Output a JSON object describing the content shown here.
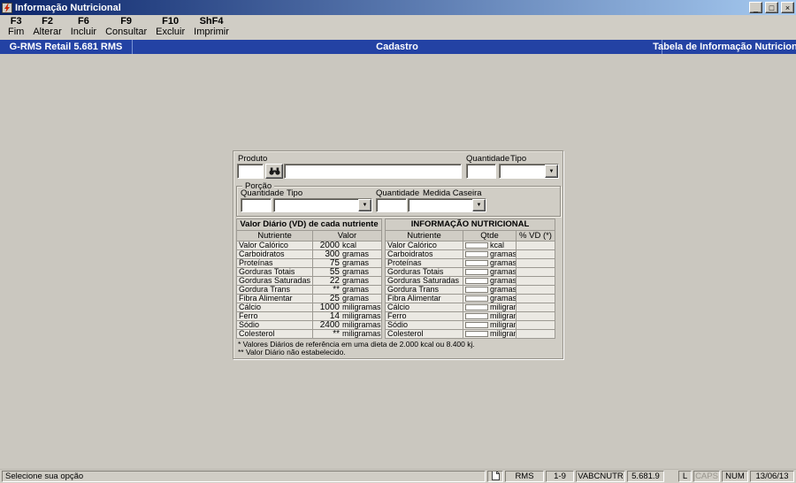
{
  "window": {
    "title": "Informação Nutricional",
    "controls": {
      "minimize": "_",
      "maximize": "□",
      "close": "×"
    }
  },
  "toolbar": {
    "buttons": [
      {
        "key": "F3",
        "label": "Fim"
      },
      {
        "key": "F2",
        "label": "Alterar"
      },
      {
        "key": "F6",
        "label": "Incluir"
      },
      {
        "key": "F9",
        "label": "Consultar"
      },
      {
        "key": "F10",
        "label": "Excluir"
      },
      {
        "key": "ShF4",
        "label": "Imprimir"
      }
    ]
  },
  "header": {
    "product": "G-RMS Retail 5.681 RMS",
    "section": "Cadastro",
    "screen": "Tabela de Informação Nutricional"
  },
  "form": {
    "produto_label": "Produto",
    "produto_code": "",
    "produto_description": "",
    "quantidade_label": "Quantidade",
    "quantidade_value": "",
    "tipo_label": "Tipo",
    "tipo_value": "",
    "porcao": {
      "title": "Porção",
      "quantidade_label": "Quantidade",
      "quantidade_value": "",
      "tipo_label": "Tipo",
      "tipo_value": "",
      "quantidade2_label": "Quantidade",
      "quantidade2_value": "",
      "medida_caseira_label": "Medida Caseira",
      "medida_caseira_value": ""
    }
  },
  "vd_table": {
    "title": "Valor Diário (VD) de cada nutriente",
    "columns": {
      "nutriente": "Nutriente",
      "valor": "Valor"
    },
    "rows": [
      {
        "nutriente": "Valor Calórico",
        "valor": "2000",
        "unidade": "kcal"
      },
      {
        "nutriente": "Carboidratos",
        "valor": "300",
        "unidade": "gramas"
      },
      {
        "nutriente": "Proteínas",
        "valor": "75",
        "unidade": "gramas"
      },
      {
        "nutriente": "Gorduras Totais",
        "valor": "55",
        "unidade": "gramas"
      },
      {
        "nutriente": "Gorduras Saturadas",
        "valor": "22",
        "unidade": "gramas"
      },
      {
        "nutriente": "Gordura Trans",
        "valor": "**",
        "unidade": "gramas"
      },
      {
        "nutriente": "Fibra Alimentar",
        "valor": "25",
        "unidade": "gramas"
      },
      {
        "nutriente": "Cálcio",
        "valor": "1000",
        "unidade": "miligramas"
      },
      {
        "nutriente": "Ferro",
        "valor": "14",
        "unidade": "miligramas"
      },
      {
        "nutriente": "Sódio",
        "valor": "2400",
        "unidade": "miligramas"
      },
      {
        "nutriente": "Colesterol",
        "valor": "**",
        "unidade": "miligramas"
      }
    ]
  },
  "info_table": {
    "title": "INFORMAÇÃO NUTRICIONAL",
    "columns": {
      "nutriente": "Nutriente",
      "qtde": "Qtde",
      "vd": "% VD (*)"
    },
    "rows": [
      {
        "nutriente": "Valor Calórico",
        "qtde": "",
        "unidade": "kcal",
        "vd": ""
      },
      {
        "nutriente": "Carboidratos",
        "qtde": "",
        "unidade": "gramas",
        "vd": ""
      },
      {
        "nutriente": "Proteínas",
        "qtde": "",
        "unidade": "gramas",
        "vd": ""
      },
      {
        "nutriente": "Gorduras Totais",
        "qtde": "",
        "unidade": "gramas",
        "vd": ""
      },
      {
        "nutriente": "Gorduras Saturadas",
        "qtde": "",
        "unidade": "gramas",
        "vd": ""
      },
      {
        "nutriente": "Gordura Trans",
        "qtde": "",
        "unidade": "gramas",
        "vd": ""
      },
      {
        "nutriente": "Fibra Alimentar",
        "qtde": "",
        "unidade": "gramas",
        "vd": ""
      },
      {
        "nutriente": "Cálcio",
        "qtde": "",
        "unidade": "miligramas",
        "vd": ""
      },
      {
        "nutriente": "Ferro",
        "qtde": "",
        "unidade": "miligramas",
        "vd": ""
      },
      {
        "nutriente": "Sódio",
        "qtde": "",
        "unidade": "miligramas",
        "vd": ""
      },
      {
        "nutriente": "Colesterol",
        "qtde": "",
        "unidade": "miligramas",
        "vd": ""
      }
    ]
  },
  "footnotes": [
    "* Valores Diários de referência em uma dieta de 2.000 kcal ou 8.400 kj.",
    "** Valor Diário não estabelecido."
  ],
  "statusbar": {
    "message": "Selecione sua opção",
    "system": "RMS",
    "record_range": "1-9",
    "program": "VABCNUTR",
    "version": "5.681.9",
    "scroll_lock": "L",
    "caps_lock": "CAPS",
    "num_lock": "NUM",
    "date": "13/06/13"
  },
  "icons": {
    "app": "lightning",
    "search": "binoculars",
    "dropdown_arrow": "▼",
    "status_file": "document"
  },
  "colors": {
    "titlebar_start": "#0a246a",
    "titlebar_end": "#a6caf0",
    "header_bar": "#2342a4",
    "background": "#d0cdc5"
  }
}
